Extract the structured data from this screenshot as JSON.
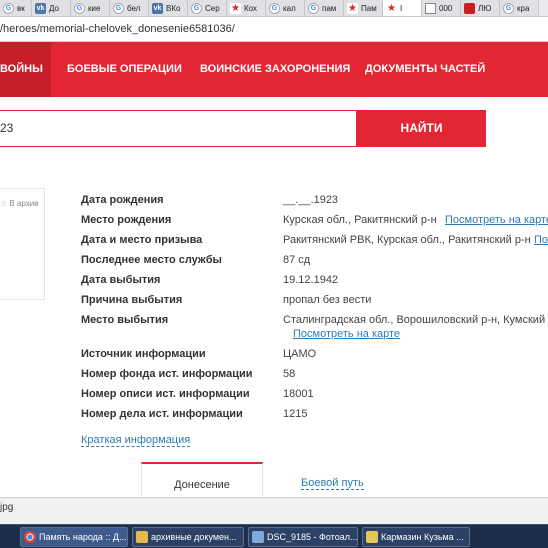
{
  "browser": {
    "tabs": [
      {
        "icon": "google-icon",
        "label": "вк"
      },
      {
        "icon": "vk-icon",
        "label": "До"
      },
      {
        "icon": "google-icon",
        "label": "кие"
      },
      {
        "icon": "google-icon",
        "label": "бел"
      },
      {
        "icon": "vk-icon",
        "label": "ВКо"
      },
      {
        "icon": "google-icon",
        "label": "Сер"
      },
      {
        "icon": "star-icon",
        "label": "Кох"
      },
      {
        "icon": "google-icon",
        "label": "кал"
      },
      {
        "icon": "google-icon",
        "label": "пам"
      },
      {
        "icon": "star-icon",
        "label": "Пам"
      },
      {
        "icon": "star-icon",
        "label": "I"
      },
      {
        "icon": "doc-icon",
        "label": "000"
      },
      {
        "icon": "red-icon",
        "label": "ЛЮ"
      },
      {
        "icon": "google-icon",
        "label": "кра"
      }
    ],
    "url": "/heroes/memorial-chelovek_donesenie6581036/"
  },
  "nav": {
    "items": [
      "ВОЙНЫ",
      "БОЕВЫЕ ОПЕРАЦИИ",
      "ВОИНСКИЕ ЗАХОРОНЕНИЯ",
      "ДОКУМЕНТЫ ЧАСТЕЙ"
    ]
  },
  "search": {
    "value": "23",
    "button": "НАЙТИ"
  },
  "photo": {
    "archive_label": "В архив"
  },
  "record": {
    "rows": [
      {
        "label": "Дата рождения",
        "value": "__.__.1923"
      },
      {
        "label": "Место рождения",
        "value": "Курская обл., Ракитянский р-н",
        "link": "Посмотреть на карте"
      },
      {
        "label": "Дата и место призыва",
        "value": "Ракитянский РВК, Курская обл., Ракитянский р-н",
        "link": "По"
      },
      {
        "label": "Последнее место службы",
        "value": "87 сд"
      },
      {
        "label": "Дата выбытия",
        "value": "19.12.1942"
      },
      {
        "label": "Причина выбытия",
        "value": "пропал без вести"
      },
      {
        "label": "Место выбытия",
        "value": "Сталинградская обл., Ворошиловский р-н, Кумский с/с",
        "link": "Посмотреть на карте"
      },
      {
        "label": "Источник информации",
        "value": "ЦАМО"
      },
      {
        "label": "Номер фонда ист. информации",
        "value": "58"
      },
      {
        "label": "Номер описи ист. информации",
        "value": "18001"
      },
      {
        "label": "Номер дела ист. информации",
        "value": "1215"
      }
    ],
    "brief_link": "Краткая информация"
  },
  "doc_tabs": {
    "active": "Донесение",
    "other": "Боевой путь"
  },
  "downloads": {
    "file": "jpg"
  },
  "taskbar": {
    "items": [
      {
        "icon": "chrome-icon",
        "label": "Память народа :: Д..."
      },
      {
        "icon": "folder-icon",
        "label": "архивные докумен..."
      },
      {
        "icon": "photoshop-icon",
        "label": "DSC_9185 - Фотоал..."
      },
      {
        "icon": "word-icon",
        "label": "Кармазин Кузьма ..."
      }
    ]
  },
  "colors": {
    "brand_red": "#e32633",
    "link_blue": "#2e7bb8"
  }
}
